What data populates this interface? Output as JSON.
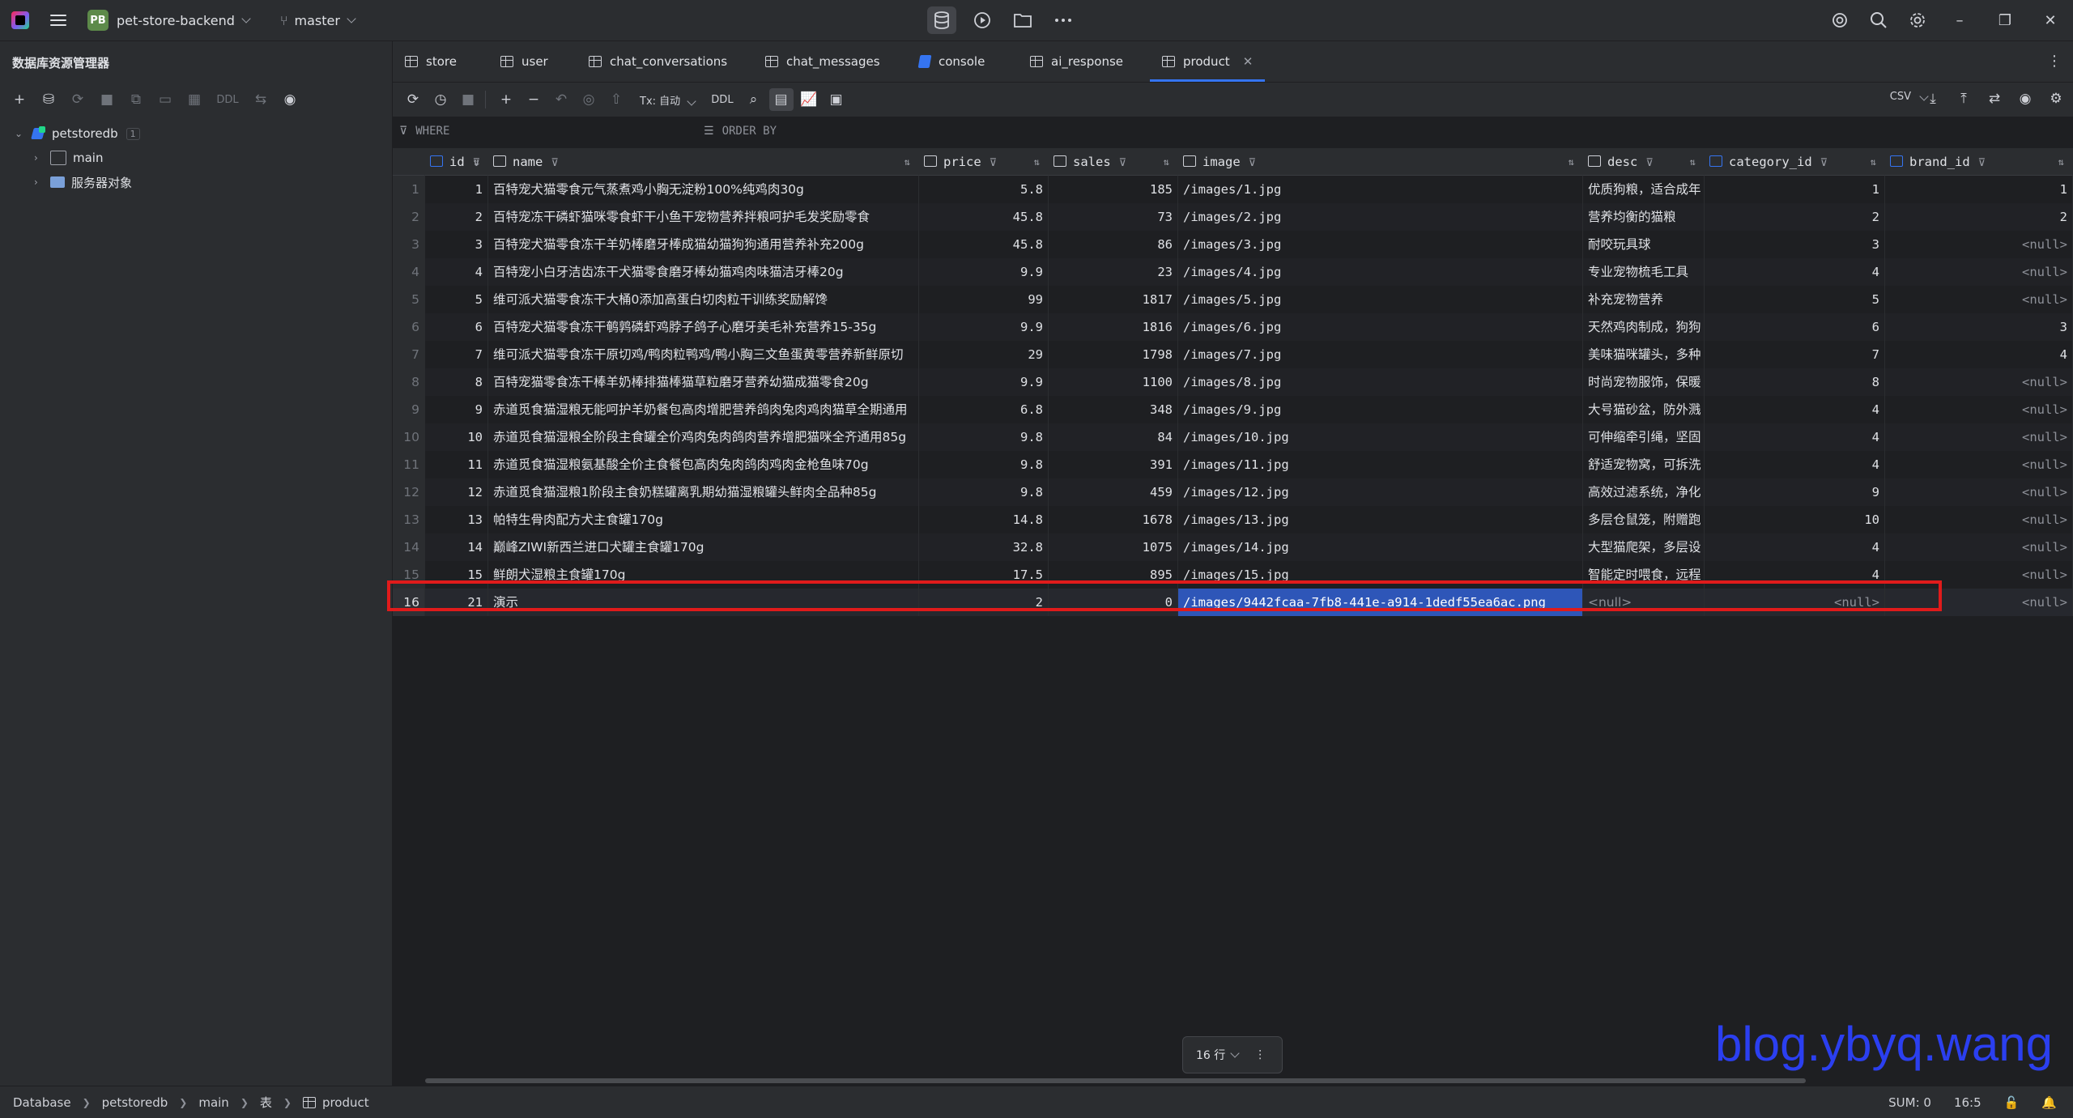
{
  "titlebar": {
    "project_badge": "PB",
    "project_name": "pet-store-backend",
    "branch": "master"
  },
  "left_panel": {
    "title": "数据库资源管理器",
    "ddl": "DDL",
    "tree": {
      "db_name": "petstoredb",
      "db_count": "1",
      "schema": "main",
      "server_objects": "服务器对象"
    }
  },
  "tabs": [
    {
      "label": "store"
    },
    {
      "label": "user"
    },
    {
      "label": "chat_conversations"
    },
    {
      "label": "chat_messages"
    },
    {
      "label": "console"
    },
    {
      "label": "ai_response"
    },
    {
      "label": "product"
    }
  ],
  "toolbar": {
    "tx_mode": "Tx: 自动",
    "ddl": "DDL",
    "export_format": "CSV"
  },
  "filter": {
    "where": "WHERE",
    "order_by": "ORDER BY"
  },
  "columns": [
    {
      "name": "id"
    },
    {
      "name": "name"
    },
    {
      "name": "price"
    },
    {
      "name": "sales"
    },
    {
      "name": "image"
    },
    {
      "name": "desc"
    },
    {
      "name": "category_id"
    },
    {
      "name": "brand_id"
    }
  ],
  "rows": [
    {
      "n": "1",
      "id": "1",
      "name": "百特宠犬猫零食元气蒸煮鸡小胸无淀粉100%纯鸡肉30g",
      "price": "5.8",
      "sales": "185",
      "image": "/images/1.jpg",
      "desc": "优质狗粮，适合成年",
      "category_id": "1",
      "brand_id": "1"
    },
    {
      "n": "2",
      "id": "2",
      "name": "百特宠冻干磷虾猫咪零食虾干小鱼干宠物营养拌粮呵护毛发奖励零食",
      "price": "45.8",
      "sales": "73",
      "image": "/images/2.jpg",
      "desc": "营养均衡的猫粮",
      "category_id": "2",
      "brand_id": "2"
    },
    {
      "n": "3",
      "id": "3",
      "name": "百特宠犬猫零食冻干羊奶棒磨牙棒成猫幼猫狗狗通用营养补充200g",
      "price": "45.8",
      "sales": "86",
      "image": "/images/3.jpg",
      "desc": "耐咬玩具球",
      "category_id": "3",
      "brand_id": "<null>"
    },
    {
      "n": "4",
      "id": "4",
      "name": "百特宠小白牙洁齿冻干犬猫零食磨牙棒幼猫鸡肉味猫洁牙棒20g",
      "price": "9.9",
      "sales": "23",
      "image": "/images/4.jpg",
      "desc": "专业宠物梳毛工具",
      "category_id": "4",
      "brand_id": "<null>"
    },
    {
      "n": "5",
      "id": "5",
      "name": "维可派犬猫零食冻干大桶0添加高蛋白切肉粒干训练奖励解馋",
      "price": "99",
      "sales": "1817",
      "image": "/images/5.jpg",
      "desc": "补充宠物营养",
      "category_id": "5",
      "brand_id": "<null>"
    },
    {
      "n": "6",
      "id": "6",
      "name": "百特宠犬猫零食冻干鹌鹑磷虾鸡脖子鸽子心磨牙美毛补充营养15-35g",
      "price": "9.9",
      "sales": "1816",
      "image": "/images/6.jpg",
      "desc": "天然鸡肉制成，狗狗",
      "category_id": "6",
      "brand_id": "3"
    },
    {
      "n": "7",
      "id": "7",
      "name": "维可派犬猫零食冻干原切鸡/鸭肉粒鸭鸡/鸭小胸三文鱼蛋黄零营养新鲜原切",
      "price": "29",
      "sales": "1798",
      "image": "/images/7.jpg",
      "desc": "美味猫咪罐头，多种",
      "category_id": "7",
      "brand_id": "4"
    },
    {
      "n": "8",
      "id": "8",
      "name": "百特宠猫零食冻干棒羊奶棒排猫棒猫草粒磨牙营养幼猫成猫零食20g",
      "price": "9.9",
      "sales": "1100",
      "image": "/images/8.jpg",
      "desc": "时尚宠物服饰，保暖",
      "category_id": "8",
      "brand_id": "<null>"
    },
    {
      "n": "9",
      "id": "9",
      "name": "赤道觅食猫湿粮无能呵护羊奶餐包高肉增肥营养鸽肉兔肉鸡肉猫草全期通用",
      "price": "6.8",
      "sales": "348",
      "image": "/images/9.jpg",
      "desc": "大号猫砂盆，防外溅",
      "category_id": "4",
      "brand_id": "<null>"
    },
    {
      "n": "10",
      "id": "10",
      "name": "赤道觅食猫湿粮全阶段主食罐全价鸡肉兔肉鸽肉营养增肥猫咪全齐通用85g",
      "price": "9.8",
      "sales": "84",
      "image": "/images/10.jpg",
      "desc": "可伸缩牵引绳，坚固",
      "category_id": "4",
      "brand_id": "<null>"
    },
    {
      "n": "11",
      "id": "11",
      "name": "赤道觅食猫湿粮氨基酸全价主食餐包高肉兔肉鸽肉鸡肉金枪鱼味70g",
      "price": "9.8",
      "sales": "391",
      "image": "/images/11.jpg",
      "desc": "舒适宠物窝，可拆洗",
      "category_id": "4",
      "brand_id": "<null>"
    },
    {
      "n": "12",
      "id": "12",
      "name": "赤道觅食猫湿粮1阶段主食奶糕罐离乳期幼猫湿粮罐头鲜肉全品种85g",
      "price": "9.8",
      "sales": "459",
      "image": "/images/12.jpg",
      "desc": "高效过滤系统，净化",
      "category_id": "9",
      "brand_id": "<null>"
    },
    {
      "n": "13",
      "id": "13",
      "name": "帕特生骨肉配方犬主食罐170g",
      "price": "14.8",
      "sales": "1678",
      "image": "/images/13.jpg",
      "desc": "多层仓鼠笼，附赠跑",
      "category_id": "10",
      "brand_id": "<null>"
    },
    {
      "n": "14",
      "id": "14",
      "name": "巅峰ZIWI新西兰进口犬罐主食罐170g",
      "price": "32.8",
      "sales": "1075",
      "image": "/images/14.jpg",
      "desc": "大型猫爬架，多层设",
      "category_id": "4",
      "brand_id": "<null>"
    },
    {
      "n": "15",
      "id": "15",
      "name": "鲜朗犬湿粮主食罐170g",
      "price": "17.5",
      "sales": "895",
      "image": "/images/15.jpg",
      "desc": "智能定时喂食，远程",
      "category_id": "4",
      "brand_id": "<null>"
    },
    {
      "n": "16",
      "id": "21",
      "name": "演示",
      "price": "2",
      "sales": "0",
      "image": "/images/9442fcaa-7fb8-441e-a914-1dedf55ea6ac.png",
      "desc": "<null>",
      "category_id": "<null>",
      "brand_id": "<null>"
    }
  ],
  "pagination": {
    "rows_label": "16 行"
  },
  "watermark": "blog.ybyq.wang",
  "statusbar": {
    "crumbs": [
      "Database",
      "petstoredb",
      "main",
      "表",
      "product"
    ],
    "sum": "SUM: 0",
    "position": "16:5"
  }
}
